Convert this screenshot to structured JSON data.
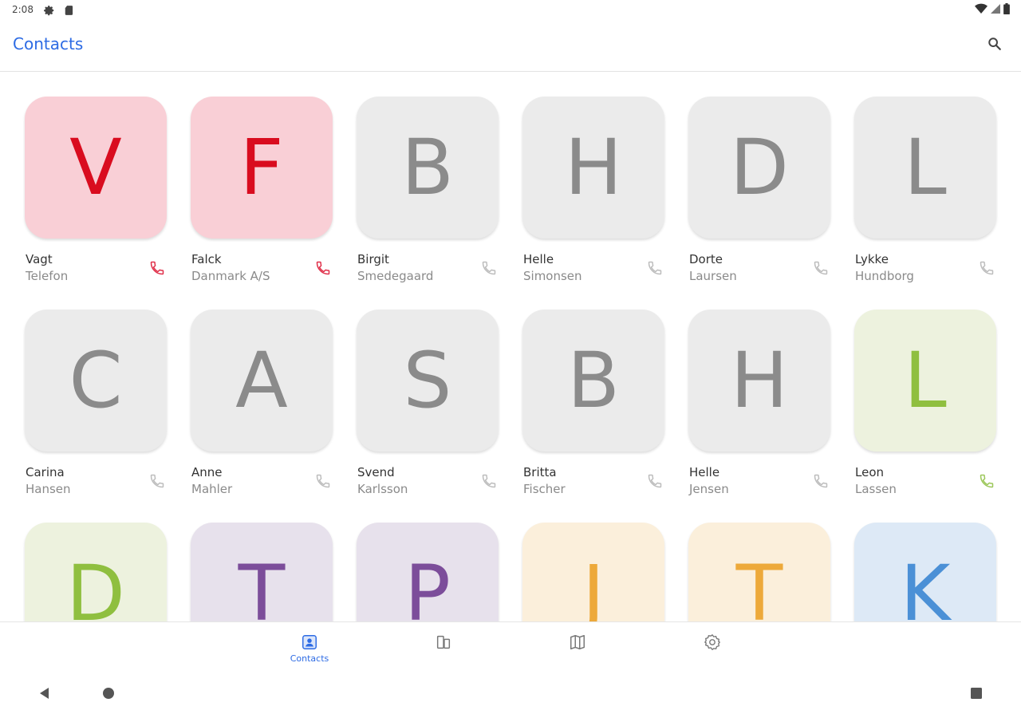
{
  "status_bar": {
    "time": "2:08",
    "left_icons": [
      "gear-icon",
      "sd-card-icon"
    ],
    "right_icons": [
      "wifi-icon",
      "signal-icon",
      "battery-icon"
    ]
  },
  "app_bar": {
    "title": "Contacts",
    "actions": [
      "search-icon"
    ]
  },
  "contacts": [
    {
      "letter": "V",
      "first": "Vagt",
      "last": "Telefon",
      "bg": "#f9cfd6",
      "fg": "#d90c1f",
      "call": "#e0304a"
    },
    {
      "letter": "F",
      "first": "Falck",
      "last": "Danmark A/S",
      "bg": "#f9cfd6",
      "fg": "#d90c1f",
      "call": "#e0304a"
    },
    {
      "letter": "B",
      "first": "Birgit",
      "last": "Smedegaard",
      "bg": "#ebebeb",
      "fg": "#8b8b8b",
      "call": "#bdbdbd"
    },
    {
      "letter": "H",
      "first": "Helle",
      "last": "Simonsen",
      "bg": "#ebebeb",
      "fg": "#8b8b8b",
      "call": "#bdbdbd"
    },
    {
      "letter": "D",
      "first": "Dorte",
      "last": "Laursen",
      "bg": "#ebebeb",
      "fg": "#8b8b8b",
      "call": "#bdbdbd"
    },
    {
      "letter": "L",
      "first": "Lykke",
      "last": "Hundborg",
      "bg": "#ebebeb",
      "fg": "#8b8b8b",
      "call": "#bdbdbd"
    },
    {
      "letter": "C",
      "first": "Carina",
      "last": "Hansen",
      "bg": "#ebebeb",
      "fg": "#8b8b8b",
      "call": "#bdbdbd"
    },
    {
      "letter": "A",
      "first": "Anne",
      "last": "Mahler",
      "bg": "#ebebeb",
      "fg": "#8b8b8b",
      "call": "#bdbdbd"
    },
    {
      "letter": "S",
      "first": "Svend",
      "last": "Karlsson",
      "bg": "#ebebeb",
      "fg": "#8b8b8b",
      "call": "#bdbdbd"
    },
    {
      "letter": "B",
      "first": "Britta",
      "last": "Fischer",
      "bg": "#ebebeb",
      "fg": "#8b8b8b",
      "call": "#bdbdbd"
    },
    {
      "letter": "H",
      "first": "Helle",
      "last": "Jensen",
      "bg": "#ebebeb",
      "fg": "#8b8b8b",
      "call": "#bdbdbd"
    },
    {
      "letter": "L",
      "first": "Leon",
      "last": "Lassen",
      "bg": "#edf2de",
      "fg": "#8fbf3f",
      "call": "#9cc75a"
    },
    {
      "letter": "D",
      "first": "",
      "last": "",
      "bg": "#edf2de",
      "fg": "#8fbf3f",
      "call": "#9cc75a"
    },
    {
      "letter": "T",
      "first": "",
      "last": "",
      "bg": "#e7e1ec",
      "fg": "#7c4d9a",
      "call": "#9b78b3"
    },
    {
      "letter": "P",
      "first": "",
      "last": "",
      "bg": "#e7e1ec",
      "fg": "#7c4d9a",
      "call": "#9b78b3"
    },
    {
      "letter": "J",
      "first": "",
      "last": "",
      "bg": "#fbefdb",
      "fg": "#eda93a",
      "call": "#eda93a"
    },
    {
      "letter": "T",
      "first": "",
      "last": "",
      "bg": "#fbefdb",
      "fg": "#eda93a",
      "call": "#eda93a"
    },
    {
      "letter": "K",
      "first": "",
      "last": "",
      "bg": "#dde9f6",
      "fg": "#4b90d6",
      "call": "#4b90d6"
    }
  ],
  "bottom_nav": {
    "items": [
      {
        "label": "Contacts",
        "icon": "contacts-icon",
        "selected": true
      },
      {
        "label": "",
        "icon": "devices-icon",
        "selected": false
      },
      {
        "label": "",
        "icon": "map-icon",
        "selected": false
      },
      {
        "label": "",
        "icon": "settings-icon",
        "selected": false
      }
    ],
    "accent": "#2d6be4"
  },
  "system_nav": [
    "back-icon",
    "home-icon",
    "recents-icon"
  ]
}
